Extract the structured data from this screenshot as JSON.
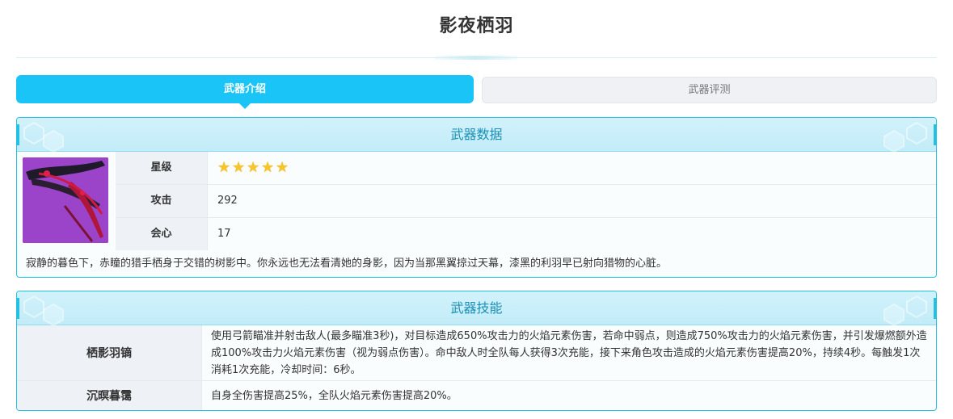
{
  "page": {
    "title": "影夜栖羽"
  },
  "tabs": [
    {
      "label": "武器介绍",
      "active": true
    },
    {
      "label": "武器评测",
      "active": false
    }
  ],
  "weapon_data": {
    "header": "武器数据",
    "stats": [
      {
        "label": "星级",
        "stars": 5
      },
      {
        "label": "攻击",
        "value": "292"
      },
      {
        "label": "会心",
        "value": "17"
      }
    ],
    "description": "寂静的暮色下，赤瞳的猎手栖身于交错的树影中。你永远也无法看清她的身影，因为当那黑翼掠过天幕，漆黑的利羽早已射向猎物的心脏。"
  },
  "weapon_skill": {
    "header": "武器技能",
    "skills": [
      {
        "name": "栖影羽镝",
        "description": "使用弓箭瞄准并射击敌人(最多瞄准3秒)，对目标造成650%攻击力的火焰元素伤害，若命中弱点，则造成750%攻击力的火焰元素伤害，并引发爆燃额外造成100%攻击力火焰元素伤害（视为弱点伤害）。命中敌人时全队每人获得3次充能，接下来角色攻击造成的火焰元素伤害提高20%，持续4秒。每触发1次消耗1次充能，冷却时间：6秒。"
      },
      {
        "name": "沉暝暮霭",
        "description": "自身全伤害提高25%，全队火焰元素伤害提高20%。"
      }
    ]
  },
  "colors": {
    "accent": "#1bc4f6",
    "panel_border": "#22c0e4",
    "header_text": "#1a8fb5",
    "star": "#f7c52a",
    "weapon_bg": "#9b44c9"
  }
}
